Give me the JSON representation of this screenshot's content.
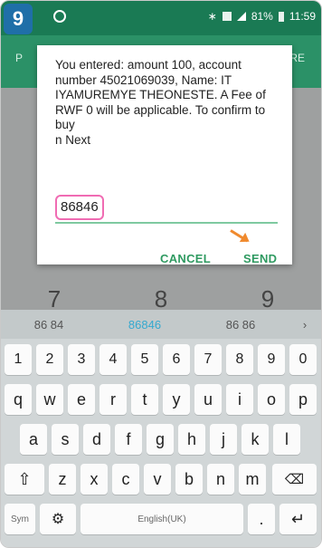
{
  "step_number": "9",
  "status": {
    "battery": "81%",
    "time": "11:59"
  },
  "appbar": {
    "left_fragment": "P",
    "right_fragment": "RE"
  },
  "dialog": {
    "message": "You entered: amount 100, account number 45021069039, Name: IT IYAMUREMYE THEONESTE. A Fee of RWF 0 will be applicable. To confirm to buy\nn Next",
    "input_value": "86846",
    "cancel_label": "CANCEL",
    "send_label": "SEND"
  },
  "backdrop_digits": [
    "7",
    "8",
    "9"
  ],
  "suggestions": [
    "86 84",
    "86846",
    "86 86"
  ],
  "suggestion_more": "›",
  "keyboard": {
    "row1": [
      "1",
      "2",
      "3",
      "4",
      "5",
      "6",
      "7",
      "8",
      "9",
      "0"
    ],
    "row2": [
      "q",
      "w",
      "e",
      "r",
      "t",
      "y",
      "u",
      "i",
      "o",
      "p"
    ],
    "row3": [
      "a",
      "s",
      "d",
      "f",
      "g",
      "h",
      "j",
      "k",
      "l"
    ],
    "row4": [
      "z",
      "x",
      "c",
      "v",
      "b",
      "n",
      "m"
    ],
    "sym_label": "Sym",
    "space_label": "English(UK)",
    "period_label": "."
  }
}
